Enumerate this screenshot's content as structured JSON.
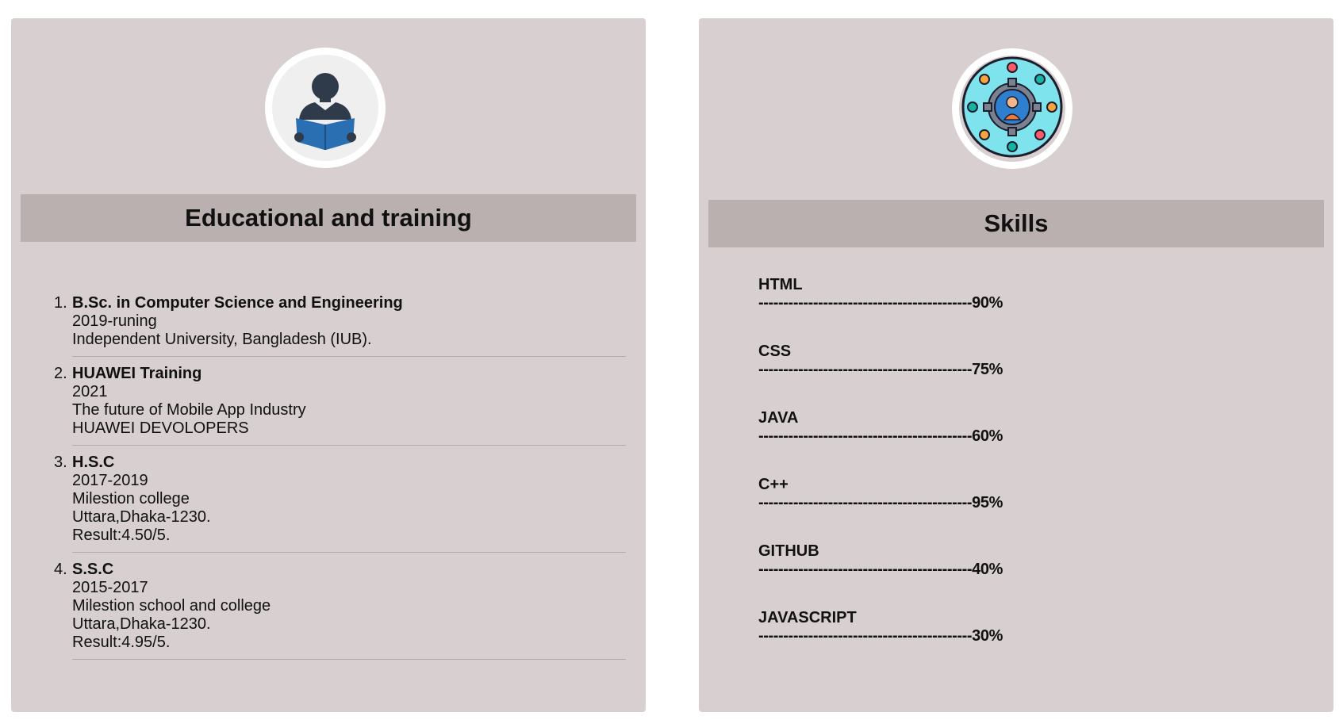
{
  "education": {
    "icon": "reader-book-icon",
    "title": "Educational and training",
    "items": [
      {
        "number": "1.",
        "title": "B.Sc. in Computer Science and Engineering",
        "lines": [
          "2019-runing",
          "Independent University, Bangladesh (IUB)."
        ]
      },
      {
        "number": "2.",
        "title": "HUAWEI Training",
        "lines": [
          "2021",
          "The future of Mobile App Industry",
          "HUAWEI DEVOLOPERS"
        ]
      },
      {
        "number": "3.",
        "title": "H.S.C",
        "lines": [
          "2017-2019",
          "Milestion college",
          "Uttara,Dhaka-1230.",
          "Result:4.50/5."
        ]
      },
      {
        "number": "4.",
        "title": "S.S.C",
        "lines": [
          "2015-2017",
          "Milestion school and college",
          "Uttara,Dhaka-1230.",
          "Result:4.95/5."
        ]
      }
    ]
  },
  "skills": {
    "icon": "skills-gear-network-icon",
    "title": "Skills",
    "items": [
      {
        "name": "HTML",
        "bar": "-------------------------------------------90%"
      },
      {
        "name": "CSS",
        "bar": "-------------------------------------------75%"
      },
      {
        "name": "JAVA",
        "bar": "-------------------------------------------60%"
      },
      {
        "name": "C++",
        "bar": "-------------------------------------------95%"
      },
      {
        "name": "GITHUB",
        "bar": "-------------------------------------------40%"
      },
      {
        "name": "JAVASCRIPT",
        "bar": "-------------------------------------------30%"
      }
    ]
  }
}
